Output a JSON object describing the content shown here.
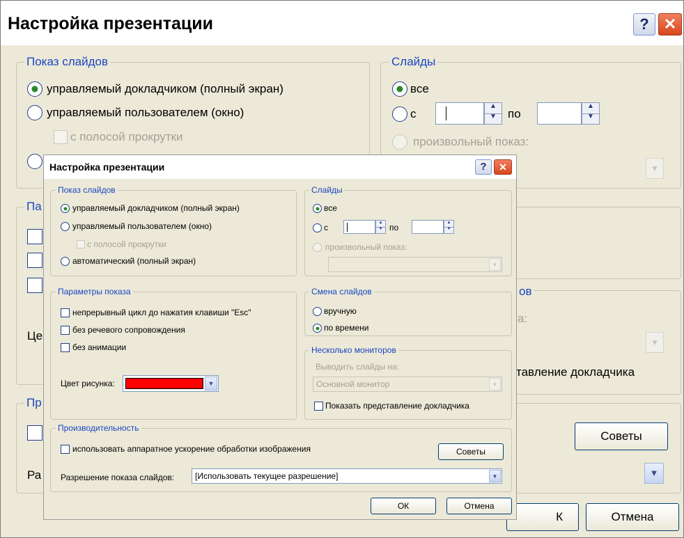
{
  "dialog_title": "Настройка презентации",
  "slide_show": {
    "legend": "Показ слайдов",
    "presenter": "управляемый докладчиком (полный экран)",
    "user": "управляемый пользователем (окно)",
    "scrollbar": "с полосой прокрутки",
    "automatic": "автоматический (полный экран)"
  },
  "slides": {
    "legend": "Слайды",
    "all": "все",
    "from": "с",
    "to": "по",
    "custom": "произвольный показ:"
  },
  "show_options": {
    "legend": "Параметры показа",
    "loop": "непрерывный цикл до нажатия клавиши \"Esc\"",
    "no_narration": "без речевого сопровождения",
    "no_animation": "без анимации",
    "pen_color": "Цвет рисунка:",
    "pen_color_value": "#ff0000"
  },
  "advance": {
    "legend": "Смена слайдов",
    "manual": "вручную",
    "timings": "по времени"
  },
  "monitors": {
    "legend": "Несколько мониторов",
    "display_on": "Выводить слайды на:",
    "primary": "Основной монитор",
    "presenter_view": "Показать представление докладчика"
  },
  "performance": {
    "legend": "Производительность",
    "hw_accel": "использовать аппаратное ускорение обработки изображения",
    "tips": "Советы",
    "resolution_label": "Разрешение показа слайдов:",
    "resolution_value": "[Использовать текущее разрешение]"
  },
  "buttons": {
    "ok": "ОК",
    "cancel": "Отмена"
  },
  "background_fragments": {
    "frag_pa": "Па",
    "frag_ce": "Це",
    "frag_pr": "Пр",
    "frag_ra": "Ра",
    "frag_ov": "ов",
    "frag_a": "а:",
    "frag_presenter_view": "тавление докладчика",
    "frag_k": "К"
  },
  "icons": {
    "help": "?",
    "close": "✕",
    "spin_up": "▲",
    "spin_down": "▼",
    "dropdown": "▼"
  }
}
